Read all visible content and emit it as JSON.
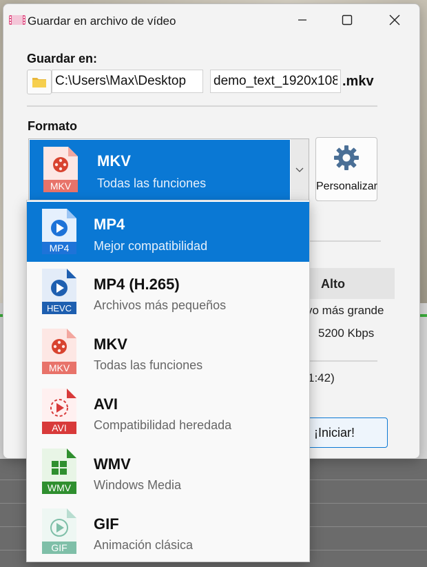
{
  "dialog": {
    "title": "Guardar en archivo de vídeo",
    "save_in_label": "Guardar en:",
    "path_value": "C:\\Users\\Max\\Desktop",
    "filename_value": "demo_text_1920x108",
    "extension": ".mkv",
    "format_label": "Formato",
    "selected_format": {
      "name": "MKV",
      "desc": "Todas las funciones"
    },
    "customize_label": "Personalizar",
    "quality_alto": "Alto",
    "peek_larger": "vo más grande",
    "peek_bitrate": "5200 Kbps",
    "peek_duration": "1:42)",
    "start_label": "¡Iniciar!"
  },
  "dropdown": {
    "items": [
      {
        "name": "MP4",
        "desc": "Mejor compatibilidad",
        "badge": "MP4",
        "icon": "mp4-file-icon",
        "color": "#1e73d8"
      },
      {
        "name": "MP4 (H.265)",
        "desc": "Archivos más pequeños",
        "badge": "HEVC",
        "icon": "hevc-file-icon",
        "color": "#1e5fb0"
      },
      {
        "name": "MKV",
        "desc": "Todas las funciones",
        "badge": "MKV",
        "icon": "mkv-file-icon",
        "color": "#e8736a"
      },
      {
        "name": "AVI",
        "desc": "Compatibilidad heredada",
        "badge": "AVI",
        "icon": "avi-file-icon",
        "color": "#d83a3a"
      },
      {
        "name": "WMV",
        "desc": "Windows Media",
        "badge": "WMV",
        "icon": "wmv-file-icon",
        "color": "#2f8f2f"
      },
      {
        "name": "GIF",
        "desc": "Animación clásica",
        "badge": "GIF",
        "icon": "gif-file-icon",
        "color": "#7fbfa8"
      }
    ]
  },
  "colors": {
    "accent": "#0a78d4"
  }
}
